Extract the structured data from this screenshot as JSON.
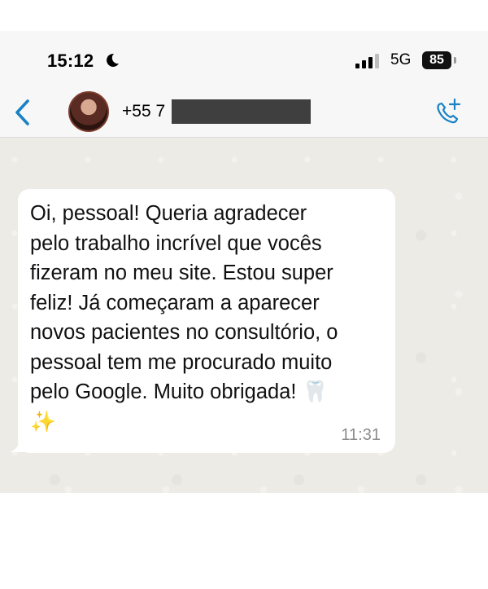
{
  "status_bar": {
    "time": "15:12",
    "network": "5G",
    "battery": "85"
  },
  "header": {
    "contact": "+55 7"
  },
  "message": {
    "text": "Oi, pessoal! Queria agradecer\npelo trabalho incrível que vocês\nfizeram no meu site. Estou super\nfeliz! Já começaram a aparecer\nnovos pacientes no consultório, o\npessoal tem me procurado muito\npelo Google. Muito obrigada! 🦷\n✨",
    "time": "11:31"
  },
  "colors": {
    "accent": "#1a82c4",
    "chat_background": "#ecebe5",
    "bubble": "#ffffff"
  },
  "icons": [
    "moon-icon",
    "signal-icon",
    "back-chevron-icon",
    "phone-add-icon"
  ]
}
